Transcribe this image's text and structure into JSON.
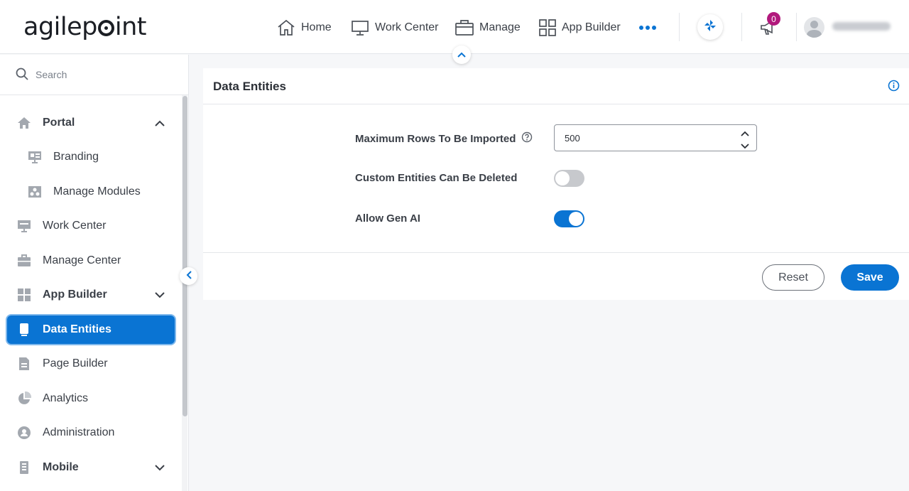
{
  "header": {
    "logo_text": "agilepoint",
    "nav": [
      {
        "label": "Home",
        "icon": "home-icon"
      },
      {
        "label": "Work Center",
        "icon": "monitor-icon"
      },
      {
        "label": "Manage",
        "icon": "briefcase-icon"
      },
      {
        "label": "App Builder",
        "icon": "grid-icon"
      }
    ],
    "more_icon": "more-dots-icon",
    "notification_count": "0",
    "accent": "#0a74d3",
    "badge_color": "#b2197d"
  },
  "sidebar": {
    "search_placeholder": "Search",
    "items": [
      {
        "label": "Portal",
        "icon": "home-icon",
        "expanded": true
      },
      {
        "label": "Branding",
        "icon": "branding-icon"
      },
      {
        "label": "Manage Modules",
        "icon": "modules-icon"
      },
      {
        "label": "Work Center",
        "icon": "monitor-icon"
      },
      {
        "label": "Manage Center",
        "icon": "briefcase-icon"
      },
      {
        "label": "App Builder",
        "icon": "grid-icon",
        "expanded": false
      },
      {
        "label": "Data Entities",
        "icon": "data-entities-icon",
        "active": true
      },
      {
        "label": "Page Builder",
        "icon": "page-icon"
      },
      {
        "label": "Analytics",
        "icon": "pie-chart-icon"
      },
      {
        "label": "Administration",
        "icon": "admin-icon"
      },
      {
        "label": "Mobile",
        "icon": "mobile-icon",
        "expanded": false
      }
    ]
  },
  "panel": {
    "title": "Data Entities",
    "fields": {
      "max_rows_label": "Maximum Rows To Be Imported",
      "max_rows_value": "500",
      "custom_delete_label": "Custom Entities Can Be Deleted",
      "custom_delete_on": false,
      "gen_ai_label": "Allow Gen AI",
      "gen_ai_on": true
    },
    "reset_label": "Reset",
    "save_label": "Save"
  }
}
